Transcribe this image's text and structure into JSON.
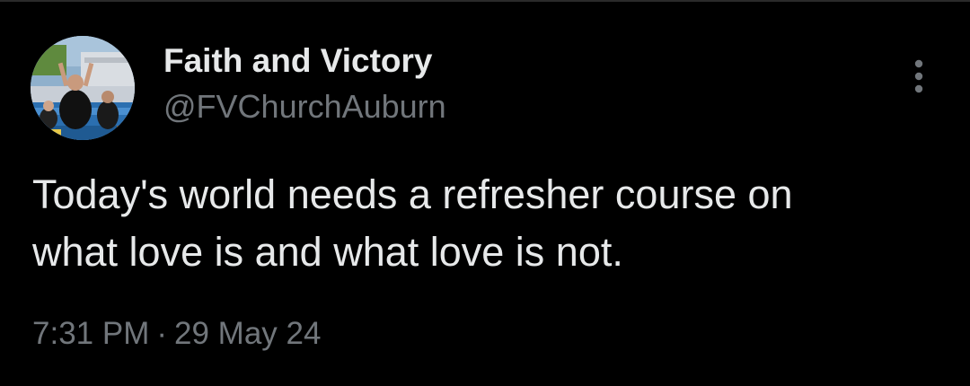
{
  "tweet": {
    "author": {
      "display_name": "Faith and Victory",
      "handle": "@FVChurchAuburn",
      "avatar_icon": "baptism-photo-avatar"
    },
    "text_line1": "Today's world needs a refresher course on",
    "text_line2": "what love is and what love is not.",
    "time": "7:31 PM",
    "separator": "·",
    "date": "29 May 24",
    "more_icon": "more-vertical-icon"
  },
  "colors": {
    "background": "#000000",
    "primary_text": "#e7e9ea",
    "secondary_text": "#71767b"
  }
}
